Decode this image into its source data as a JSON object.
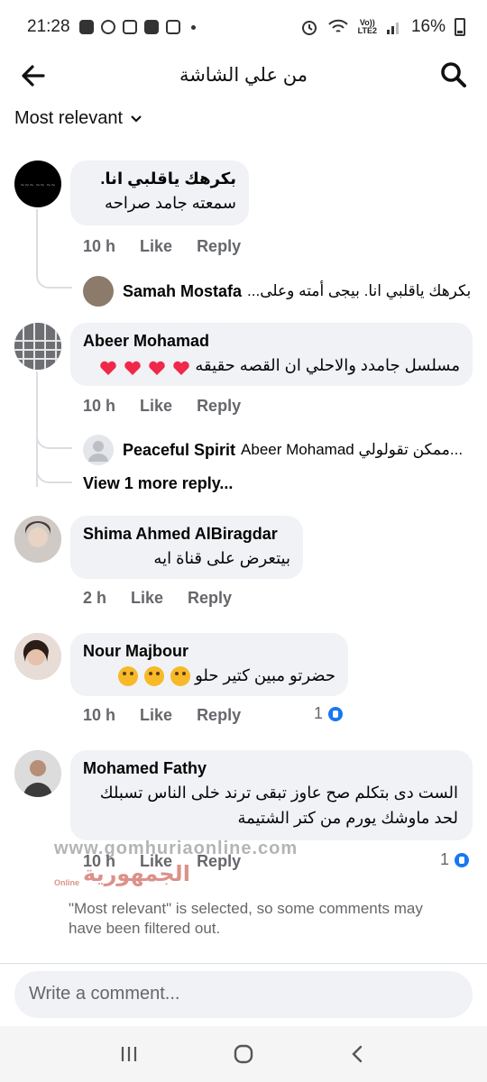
{
  "status_bar": {
    "time": "21:28",
    "network_top": "Vo))",
    "network_bottom": "LTE2",
    "battery": "16%"
  },
  "header": {
    "title": "من علي الشاشة",
    "back_icon": "arrow-left-icon",
    "search_icon": "search-icon"
  },
  "sort": {
    "label": "Most relevant"
  },
  "comments": [
    {
      "name": "بكرهك ياقلبي انا.",
      "text": "سمعته جامد صراحه",
      "time": "10 h",
      "like": "Like",
      "reply": "Reply",
      "reply_preview": {
        "name": "Samah Mostafa",
        "text": "بكرهك ياقلبي انا. بيجى أمته وعلى..."
      }
    },
    {
      "name": "Abeer Mohamad",
      "text": "مسلسل جامدد والاحلي ان القصه حقيقه",
      "time": "10 h",
      "like": "Like",
      "reply": "Reply",
      "reply_preview": {
        "name": "Peaceful Spirit",
        "text": "Abeer Mohamad ممكن تقولولي..."
      },
      "more_replies": "View 1 more reply..."
    },
    {
      "name": "Shima Ahmed AlBiragdar",
      "text": "بيتعرض على قناة ايه",
      "time": "2 h",
      "like": "Like",
      "reply": "Reply"
    },
    {
      "name": "Nour Majbour",
      "text": "حضرتو مبين كتير حلو",
      "time": "10 h",
      "like": "Like",
      "reply": "Reply",
      "reaction_count": "1"
    },
    {
      "name": "Mohamed Fathy",
      "text": "الست دى بتكلم صح عاوز تبقى ترند خلى الناس تسبلك لحد ماوشك يورم من كتر الشتيمة",
      "time": "10 h",
      "like": "Like",
      "reply": "Reply",
      "reaction_count": "1"
    }
  ],
  "notice": "\"Most relevant\" is selected, so some comments may have been filtered out.",
  "watermark": {
    "site": "www.gomhuriaonline.com",
    "brand": "الجمهورية",
    "brand_small": "Online"
  },
  "composer": {
    "placeholder": "Write a comment..."
  },
  "colors": {
    "bubble": "#f0f2f5",
    "meta": "#65676b",
    "like_blue": "#1877f2",
    "emoji_yellow": "#f7b928",
    "heart_red": "#f02849"
  }
}
